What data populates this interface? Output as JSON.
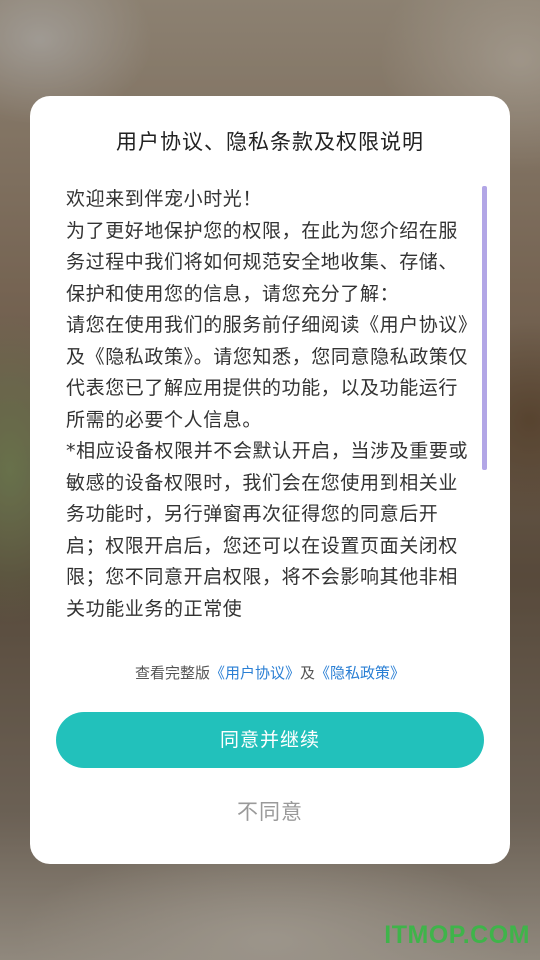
{
  "dialog": {
    "title": "用户协议、隐私条款及权限说明",
    "paragraphs": [
      "欢迎来到伴宠小时光！",
      "为了更好地保护您的权限，在此为您介绍在服务过程中我们将如何规范安全地收集、存储、保护和使用您的信息，请您充分了解：",
      "请您在使用我们的服务前仔细阅读《用户协议》及《隐私政策》。请您知悉，您同意隐私政策仅代表您已了解应用提供的功能，以及功能运行所需的必要个人信息。",
      "*相应设备权限并不会默认开启，当涉及重要或敏感的设备权限时，我们会在您使用到相关业务功能时，另行弹窗再次征得您的同意后开启；权限开启后，您还可以在设置页面关闭权限；您不同意开启权限，将不会影响其他非相关功能业务的正常使"
    ],
    "links": {
      "prefix": "查看完整版",
      "user_agreement": "《用户协议》",
      "conjunction": "及",
      "privacy_policy": "《隐私政策》"
    },
    "agree_label": "同意并继续",
    "disagree_label": "不同意"
  },
  "watermark": "ITMOP.COM",
  "colors": {
    "accent": "#22c1bb",
    "link": "#2a7fd4",
    "scrollbar": "#b2a6e6",
    "watermark": "#3fb44a"
  }
}
